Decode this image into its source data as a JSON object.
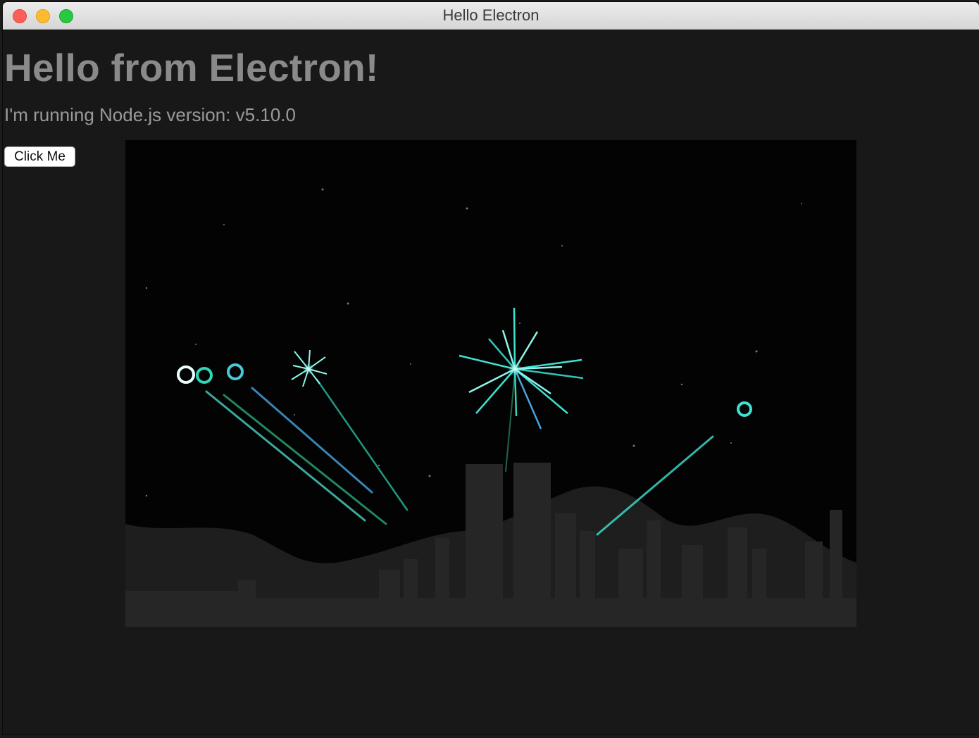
{
  "window": {
    "title": "Hello Electron"
  },
  "page": {
    "heading": "Hello from Electron!",
    "version_text": "I'm running Node.js version: v5.10.0",
    "button_label": "Click Me"
  },
  "colors": {
    "firework": "#3fe0d0",
    "sky": "#030303",
    "hills": "#1e1e1e",
    "city": "#252525",
    "text": "#8a8a8a"
  },
  "icons": [
    "close-light-icon",
    "minimize-light-icon",
    "maximize-light-icon"
  ]
}
